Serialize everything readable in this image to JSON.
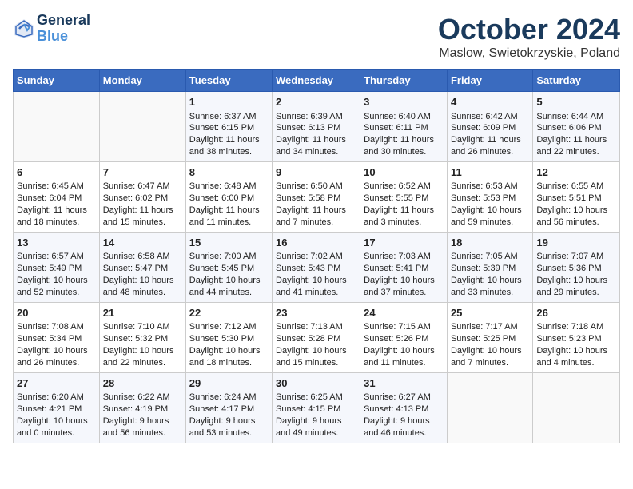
{
  "header": {
    "logo_line1": "General",
    "logo_line2": "Blue",
    "month_title": "October 2024",
    "location": "Maslow, Swietokrzyskie, Poland"
  },
  "days_of_week": [
    "Sunday",
    "Monday",
    "Tuesday",
    "Wednesday",
    "Thursday",
    "Friday",
    "Saturday"
  ],
  "weeks": [
    [
      {
        "day": "",
        "content": ""
      },
      {
        "day": "",
        "content": ""
      },
      {
        "day": "1",
        "content": "Sunrise: 6:37 AM\nSunset: 6:15 PM\nDaylight: 11 hours\nand 38 minutes."
      },
      {
        "day": "2",
        "content": "Sunrise: 6:39 AM\nSunset: 6:13 PM\nDaylight: 11 hours\nand 34 minutes."
      },
      {
        "day": "3",
        "content": "Sunrise: 6:40 AM\nSunset: 6:11 PM\nDaylight: 11 hours\nand 30 minutes."
      },
      {
        "day": "4",
        "content": "Sunrise: 6:42 AM\nSunset: 6:09 PM\nDaylight: 11 hours\nand 26 minutes."
      },
      {
        "day": "5",
        "content": "Sunrise: 6:44 AM\nSunset: 6:06 PM\nDaylight: 11 hours\nand 22 minutes."
      }
    ],
    [
      {
        "day": "6",
        "content": "Sunrise: 6:45 AM\nSunset: 6:04 PM\nDaylight: 11 hours\nand 18 minutes."
      },
      {
        "day": "7",
        "content": "Sunrise: 6:47 AM\nSunset: 6:02 PM\nDaylight: 11 hours\nand 15 minutes."
      },
      {
        "day": "8",
        "content": "Sunrise: 6:48 AM\nSunset: 6:00 PM\nDaylight: 11 hours\nand 11 minutes."
      },
      {
        "day": "9",
        "content": "Sunrise: 6:50 AM\nSunset: 5:58 PM\nDaylight: 11 hours\nand 7 minutes."
      },
      {
        "day": "10",
        "content": "Sunrise: 6:52 AM\nSunset: 5:55 PM\nDaylight: 11 hours\nand 3 minutes."
      },
      {
        "day": "11",
        "content": "Sunrise: 6:53 AM\nSunset: 5:53 PM\nDaylight: 10 hours\nand 59 minutes."
      },
      {
        "day": "12",
        "content": "Sunrise: 6:55 AM\nSunset: 5:51 PM\nDaylight: 10 hours\nand 56 minutes."
      }
    ],
    [
      {
        "day": "13",
        "content": "Sunrise: 6:57 AM\nSunset: 5:49 PM\nDaylight: 10 hours\nand 52 minutes."
      },
      {
        "day": "14",
        "content": "Sunrise: 6:58 AM\nSunset: 5:47 PM\nDaylight: 10 hours\nand 48 minutes."
      },
      {
        "day": "15",
        "content": "Sunrise: 7:00 AM\nSunset: 5:45 PM\nDaylight: 10 hours\nand 44 minutes."
      },
      {
        "day": "16",
        "content": "Sunrise: 7:02 AM\nSunset: 5:43 PM\nDaylight: 10 hours\nand 41 minutes."
      },
      {
        "day": "17",
        "content": "Sunrise: 7:03 AM\nSunset: 5:41 PM\nDaylight: 10 hours\nand 37 minutes."
      },
      {
        "day": "18",
        "content": "Sunrise: 7:05 AM\nSunset: 5:39 PM\nDaylight: 10 hours\nand 33 minutes."
      },
      {
        "day": "19",
        "content": "Sunrise: 7:07 AM\nSunset: 5:36 PM\nDaylight: 10 hours\nand 29 minutes."
      }
    ],
    [
      {
        "day": "20",
        "content": "Sunrise: 7:08 AM\nSunset: 5:34 PM\nDaylight: 10 hours\nand 26 minutes."
      },
      {
        "day": "21",
        "content": "Sunrise: 7:10 AM\nSunset: 5:32 PM\nDaylight: 10 hours\nand 22 minutes."
      },
      {
        "day": "22",
        "content": "Sunrise: 7:12 AM\nSunset: 5:30 PM\nDaylight: 10 hours\nand 18 minutes."
      },
      {
        "day": "23",
        "content": "Sunrise: 7:13 AM\nSunset: 5:28 PM\nDaylight: 10 hours\nand 15 minutes."
      },
      {
        "day": "24",
        "content": "Sunrise: 7:15 AM\nSunset: 5:26 PM\nDaylight: 10 hours\nand 11 minutes."
      },
      {
        "day": "25",
        "content": "Sunrise: 7:17 AM\nSunset: 5:25 PM\nDaylight: 10 hours\nand 7 minutes."
      },
      {
        "day": "26",
        "content": "Sunrise: 7:18 AM\nSunset: 5:23 PM\nDaylight: 10 hours\nand 4 minutes."
      }
    ],
    [
      {
        "day": "27",
        "content": "Sunrise: 6:20 AM\nSunset: 4:21 PM\nDaylight: 10 hours\nand 0 minutes."
      },
      {
        "day": "28",
        "content": "Sunrise: 6:22 AM\nSunset: 4:19 PM\nDaylight: 9 hours\nand 56 minutes."
      },
      {
        "day": "29",
        "content": "Sunrise: 6:24 AM\nSunset: 4:17 PM\nDaylight: 9 hours\nand 53 minutes."
      },
      {
        "day": "30",
        "content": "Sunrise: 6:25 AM\nSunset: 4:15 PM\nDaylight: 9 hours\nand 49 minutes."
      },
      {
        "day": "31",
        "content": "Sunrise: 6:27 AM\nSunset: 4:13 PM\nDaylight: 9 hours\nand 46 minutes."
      },
      {
        "day": "",
        "content": ""
      },
      {
        "day": "",
        "content": ""
      }
    ]
  ]
}
